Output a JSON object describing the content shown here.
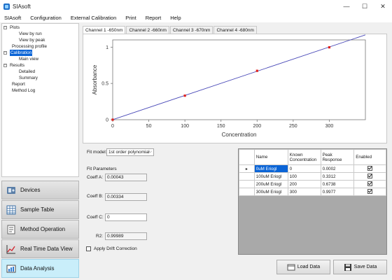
{
  "window": {
    "title": "SIAsoft"
  },
  "menu": [
    "SIAsoft",
    "Configuration",
    "External Calibration",
    "Print",
    "Report",
    "Help"
  ],
  "tree": [
    {
      "label": "Plots",
      "level": 0,
      "toggle": "−"
    },
    {
      "label": "View by run",
      "level": 2
    },
    {
      "label": "View by peak",
      "level": 2
    },
    {
      "label": "Processing profile",
      "level": 1
    },
    {
      "label": "Calibration",
      "level": 0,
      "toggle": "−",
      "selected": true
    },
    {
      "label": "Main view",
      "level": 2
    },
    {
      "label": "Results",
      "level": 0,
      "toggle": "−"
    },
    {
      "label": "Detailed",
      "level": 2
    },
    {
      "label": "Summary",
      "level": 2
    },
    {
      "label": "Report",
      "level": 1
    },
    {
      "label": "Method Log",
      "level": 1
    }
  ],
  "nav": [
    {
      "label": "Devices",
      "icon": "devices-icon"
    },
    {
      "label": "Sample Table",
      "icon": "sample-table-icon"
    },
    {
      "label": "Method Operation",
      "icon": "method-operation-icon"
    },
    {
      "label": "Real Time Data View",
      "icon": "real-time-chart-icon"
    },
    {
      "label": "Data Analysis",
      "icon": "data-analysis-icon",
      "active": true
    }
  ],
  "tabs": [
    "Channel 1 -650nm",
    "Channel 2 -660nm",
    "Channel 3 -670nm",
    "Channel 4 -680nm"
  ],
  "chart_data": {
    "type": "scatter",
    "xlabel": "Concentration",
    "ylabel": "Absorbance",
    "xlim": [
      0,
      350
    ],
    "ylim": [
      0,
      1.1
    ],
    "xticks": [
      0,
      50,
      100,
      150,
      200,
      250,
      300
    ],
    "yticks": [
      0,
      0.5,
      1
    ],
    "ytick_labels": [
      "0",
      "0.5",
      "1"
    ],
    "points": [
      {
        "x": 0,
        "y": 0.0002
      },
      {
        "x": 100,
        "y": 0.3312
      },
      {
        "x": 200,
        "y": 0.6738
      },
      {
        "x": 300,
        "y": 0.9977
      }
    ],
    "fit_line": {
      "x": [
        0,
        350
      ],
      "y": [
        0.00043,
        1.16943
      ]
    },
    "grid": false,
    "colors": {
      "points": "#e0201b",
      "line": "#4a4ab8"
    }
  },
  "fit": {
    "model_label": "Fit model:",
    "model_value": "1st order polynomial",
    "params_title": "Fit Parameters",
    "coeff_a_label": "Coeff A:",
    "coeff_a": "0.00043",
    "coeff_b_label": "Coeff B:",
    "coeff_b": "0.00334",
    "coeff_c_label": "Coeff C:",
    "coeff_c": "0",
    "r2_label": "R2:",
    "r2": "0.99989",
    "drift_label": "Apply Drift Correction"
  },
  "table": {
    "headers": [
      "Name",
      "Known\nConcentration",
      "Peak\nResponse",
      "Enabled"
    ],
    "rows": [
      {
        "name": "0uM Eriogl",
        "known": "0",
        "peak": "0.0002",
        "enabled": true
      },
      {
        "name": "100uM Eriogl",
        "known": "100",
        "peak": "0.3312",
        "enabled": true
      },
      {
        "name": "200uM Eriogl",
        "known": "200",
        "peak": "0.6738",
        "enabled": true
      },
      {
        "name": "300uM Eriogl",
        "known": "300",
        "peak": "0.9977",
        "enabled": true
      }
    ]
  },
  "buttons": {
    "load": "Load Data",
    "save": "Save Data"
  }
}
